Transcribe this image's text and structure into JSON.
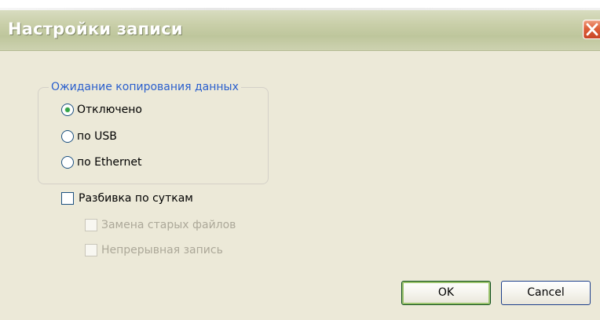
{
  "window": {
    "title": "Настройки записи"
  },
  "group": {
    "label": "Ожидание копирования данных",
    "options": [
      {
        "label": "Отключено",
        "selected": true
      },
      {
        "label": "по USB",
        "selected": false
      },
      {
        "label": "по Ethernet",
        "selected": false
      }
    ]
  },
  "checkboxes": {
    "daily_split": {
      "label": "Разбивка по суткам",
      "checked": false,
      "enabled": true
    },
    "replace_old_files": {
      "label": "Замена старых файлов",
      "checked": false,
      "enabled": false
    },
    "continuous_recording": {
      "label": "Непрерывная запись",
      "checked": false,
      "enabled": false
    }
  },
  "buttons": {
    "ok": "OK",
    "cancel": "Cancel"
  },
  "icons": {
    "close": "close-icon",
    "radio_selected": "radio-selected-icon",
    "radio_unselected": "radio-unselected-icon",
    "checkbox": "checkbox-icon"
  },
  "colors": {
    "dialog_bg": "#ece9d8",
    "title_text": "#ffffff",
    "group_label": "#2a5fcd",
    "disabled_text": "#aca899",
    "radio_selected": "#33a447",
    "close_button": "#dd5f39"
  }
}
